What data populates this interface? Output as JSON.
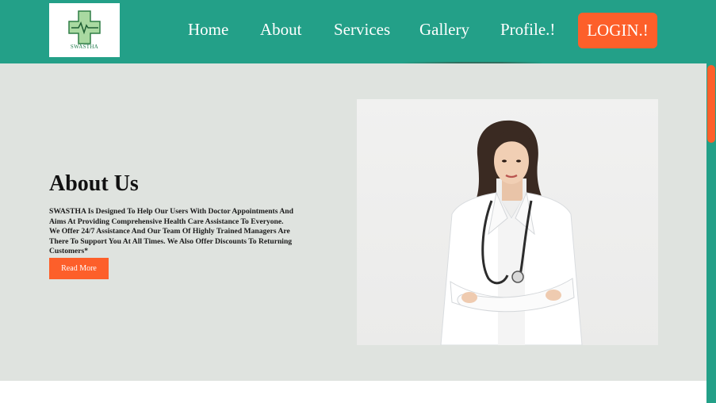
{
  "brand": {
    "name": "SWASTHA"
  },
  "nav": {
    "items": [
      {
        "label": "Home"
      },
      {
        "label": "About"
      },
      {
        "label": "Services"
      },
      {
        "label": "Gallery"
      },
      {
        "label": "Profile.!"
      }
    ],
    "login_label": "LOGIN.!"
  },
  "about": {
    "title": "About Us",
    "description": "SWASTHA Is Designed To Help Our Users With Doctor Appointments And Aims At Providing Comprehensive Health Care Assistance To Everyone. We Offer 24/7 Assistance And Our Team Of Highly Trained Managers Are There To Support You At All Times. We Also Offer Discounts To Returning Customers*",
    "button_label": "Read More"
  },
  "colors": {
    "nav_background": "#23a088",
    "accent": "#fd5f2a",
    "hero_background": "#dfe3df"
  }
}
